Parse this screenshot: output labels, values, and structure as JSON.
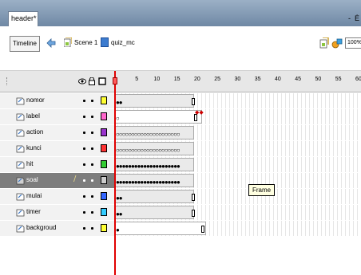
{
  "window": {
    "tab_title": "header*",
    "controls": "-  Ė"
  },
  "toolbar": {
    "timeline_label": "Timeline",
    "scene_label": "Scene 1",
    "movieclip_label": "quiz_mc",
    "zoom_value": "100%"
  },
  "ruler": {
    "numbers": [
      "5",
      "10",
      "15",
      "20",
      "25",
      "30",
      "35",
      "40",
      "45",
      "50",
      "55",
      "60"
    ]
  },
  "layers": [
    {
      "name": "nomor",
      "color": "#ffff33",
      "selected": false
    },
    {
      "name": "label",
      "color": "#ff66cc",
      "selected": false
    },
    {
      "name": "action",
      "color": "#9933cc",
      "selected": false
    },
    {
      "name": "kunci",
      "color": "#ff3333",
      "selected": false
    },
    {
      "name": "hit",
      "color": "#33cc33",
      "selected": false
    },
    {
      "name": "soal",
      "color": "#cccccc",
      "selected": true
    },
    {
      "name": "mulai",
      "color": "#3366ff",
      "selected": false
    },
    {
      "name": "timer",
      "color": "#33ccff",
      "selected": false
    },
    {
      "name": "backgroud",
      "color": "#ffff33",
      "selected": false
    }
  ],
  "tooltip": {
    "text": "Frame"
  },
  "colors": {
    "titlebar": "#7f97b2",
    "playhead": "#e00000",
    "selected_layer": "#7d7d7d"
  }
}
